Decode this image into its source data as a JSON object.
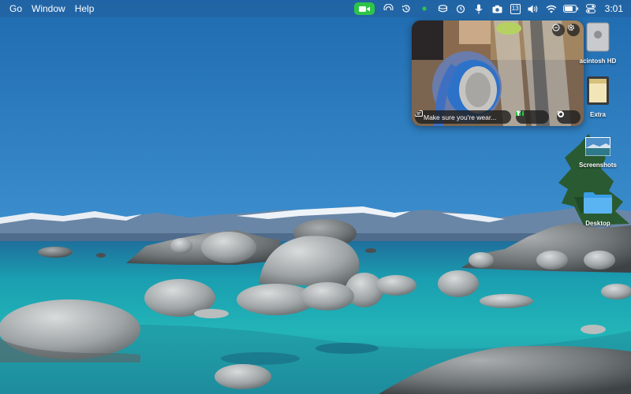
{
  "menubar": {
    "items": [
      "Go",
      "Window",
      "Help"
    ],
    "status_icons": [
      "facetime-camera-icon",
      "airplay-icon",
      "time-machine-icon",
      "green-dot-icon",
      "sync-icon",
      "timer-icon",
      "microphone-icon",
      "camera-icon",
      "calendar-icon",
      "volume-icon",
      "wifi-icon",
      "battery-icon",
      "control-center-icon"
    ],
    "calendar_day": "13",
    "clock": "3:01",
    "accent": "#2ec44a"
  },
  "preview": {
    "caption": "Make sure you're wear...",
    "buttons": [
      "reactions-icon",
      "settings-icon"
    ]
  },
  "desktop_icons": [
    {
      "label": "acintosh HD",
      "icon": "hard-drive-icon"
    },
    {
      "label": "Extra",
      "icon": "disk-image-icon"
    },
    {
      "label": "Screenshots",
      "icon": "screenshot-thumbnail-icon"
    },
    {
      "label": "Desktop",
      "icon": "folder-icon"
    }
  ]
}
